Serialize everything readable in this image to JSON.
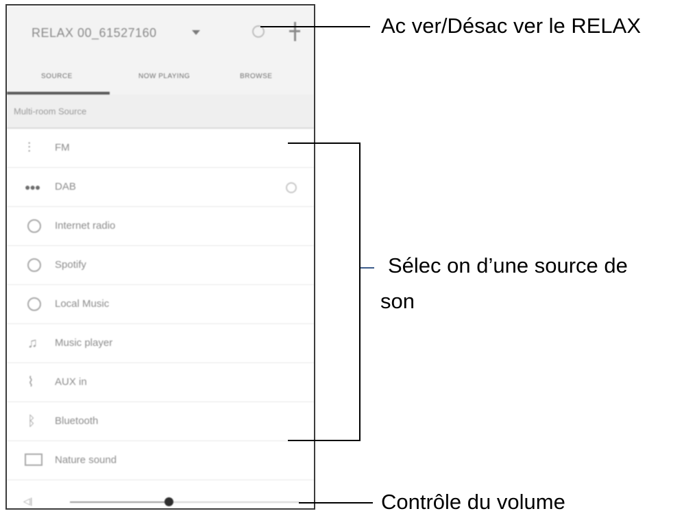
{
  "app": {
    "device_name": "RELAX 00_61527160",
    "icons": {
      "dropdown": "caret-down-icon",
      "power": "power-icon",
      "add": "plus-icon"
    }
  },
  "tabs": [
    {
      "label": "SOURCE",
      "active": true
    },
    {
      "label": "NOW PLAYING",
      "active": false
    },
    {
      "label": "BROWSE",
      "active": false
    }
  ],
  "section_title": "Multi-room Source",
  "sources": [
    {
      "label": "FM",
      "icon": "fm-radio-icon"
    },
    {
      "label": "DAB",
      "icon": "dab-icon",
      "trailing": "settings-icon"
    },
    {
      "label": "Internet radio",
      "icon": "internet-radio-icon"
    },
    {
      "label": "Spotify",
      "icon": "spotify-icon"
    },
    {
      "label": "Local Music",
      "icon": "local-music-icon"
    },
    {
      "label": "Music player",
      "icon": "music-note-icon"
    },
    {
      "label": "AUX in",
      "icon": "aux-in-icon"
    },
    {
      "label": "Bluetooth",
      "icon": "bluetooth-icon"
    },
    {
      "label": "Nature sound",
      "icon": "nature-sound-icon"
    }
  ],
  "volume": {
    "icon": "speaker-icon",
    "level": 0.43
  },
  "annotations": {
    "power": "Ac ver/Désac ver le RELAX",
    "source_line1": "Sélec on d’une source de",
    "source_line2": "son",
    "volume": "Contrôle du volume"
  }
}
